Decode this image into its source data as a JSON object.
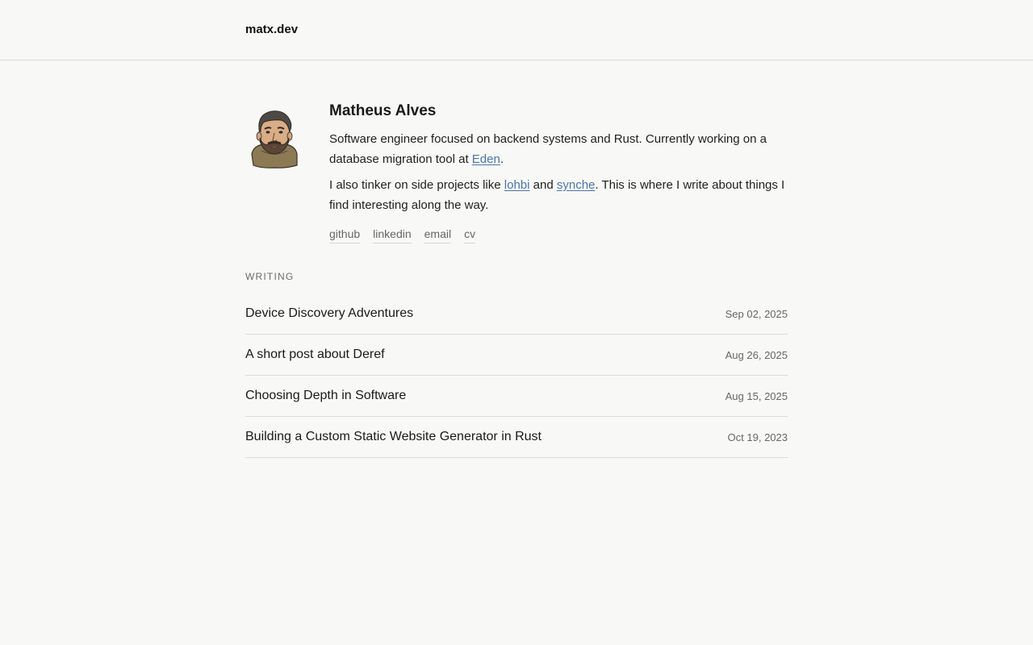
{
  "header": {
    "site_title": "matx.dev"
  },
  "profile": {
    "name": "Matheus Alves",
    "bio1": {
      "before": "Software engineer focused on backend systems and Rust. Currently working on a database migration tool at ",
      "link": "Eden",
      "after": "."
    },
    "bio2": {
      "before": "I also tinker on side projects like ",
      "link1": "lohbi",
      "middle": " and ",
      "link2": "synche",
      "after": ". This is where I write about things I find interesting along the way."
    },
    "links": [
      "github",
      "linkedin",
      "email",
      "cv"
    ]
  },
  "writing": {
    "label": "WRITING",
    "posts": [
      {
        "title": "Device Discovery Adventures",
        "date": "Sep 02, 2025"
      },
      {
        "title": "A short post about Deref",
        "date": "Aug 26, 2025"
      },
      {
        "title": "Choosing Depth in Software",
        "date": "Aug 15, 2025"
      },
      {
        "title": "Building a Custom Static Website Generator in Rust",
        "date": "Oct 19, 2023"
      }
    ]
  },
  "colors": {
    "background": "#f8f8f6",
    "link": "#4a76a8",
    "divider": "#dcdcda"
  }
}
